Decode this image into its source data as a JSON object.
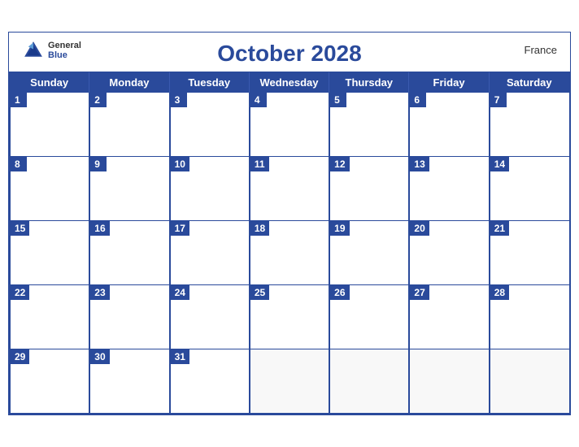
{
  "header": {
    "title": "October 2028",
    "country": "France",
    "logo_general": "General",
    "logo_blue": "Blue"
  },
  "days_of_week": [
    "Sunday",
    "Monday",
    "Tuesday",
    "Wednesday",
    "Thursday",
    "Friday",
    "Saturday"
  ],
  "weeks": [
    [
      1,
      2,
      3,
      4,
      5,
      6,
      7
    ],
    [
      8,
      9,
      10,
      11,
      12,
      13,
      14
    ],
    [
      15,
      16,
      17,
      18,
      19,
      20,
      21
    ],
    [
      22,
      23,
      24,
      25,
      26,
      27,
      28
    ],
    [
      29,
      30,
      31,
      null,
      null,
      null,
      null
    ]
  ],
  "colors": {
    "header_bg": "#2a4a9b",
    "header_text": "#ffffff",
    "title_color": "#2a4a9b",
    "border_color": "#2a4a9b"
  }
}
